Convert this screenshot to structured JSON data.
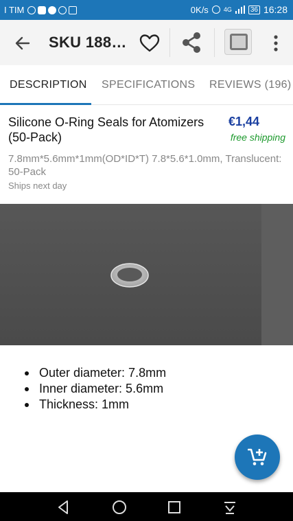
{
  "status_bar": {
    "carrier": "I TIM",
    "net_speed": "0K/s",
    "signal": "4G",
    "battery": "36",
    "time": "16:28"
  },
  "toolbar": {
    "title": "SKU 188…",
    "back_icon": "arrow-left-icon",
    "favorite_icon": "heart-outline-icon",
    "share_icon": "share-icon",
    "more_icon": "more-vert-icon"
  },
  "tabs": [
    {
      "label": "DESCRIPTION",
      "active": true
    },
    {
      "label": "SPECIFICATIONS",
      "active": false
    },
    {
      "label": "REVIEWS (196)",
      "active": false
    }
  ],
  "product": {
    "title": "Silicone O-Ring Seals for Atomizers (50-Pack)",
    "price": "€1,44",
    "shipping": "free shipping",
    "subtitle": "7.8mm*5.6mm*1mm(OD*ID*T) 7.8*5.6*1.0mm, Translucent: 50-Pack",
    "ships_note": "Ships next day"
  },
  "features": [
    "Outer diameter: 7.8mm",
    "Inner diameter: 5.6mm",
    "Thickness: 1mm"
  ],
  "fab": {
    "icon": "add-to-cart-icon"
  },
  "colors": {
    "accent": "#1d76b8",
    "price": "#1a3fa0",
    "shipping": "#1e9a2e"
  }
}
